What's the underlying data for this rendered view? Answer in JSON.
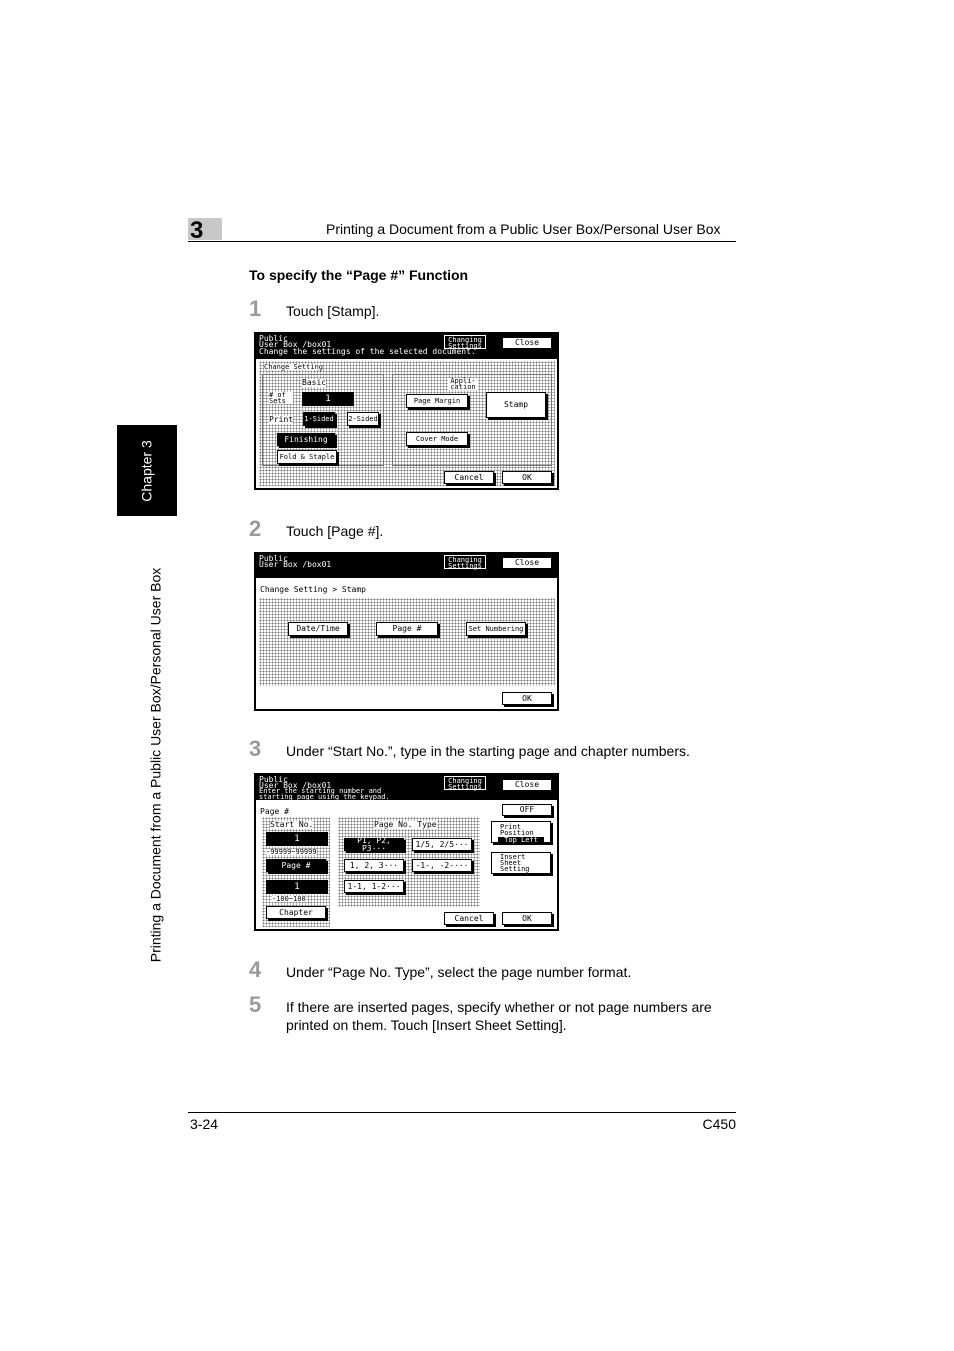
{
  "header": {
    "chapter_number": "3",
    "title": "Printing a Document from a Public User Box/Personal User Box"
  },
  "section_title": "To specify the “Page #” Function",
  "side": {
    "tab_label": "Chapter 3",
    "vertical_title": "Printing a Document from a Public User Box/Personal User Box"
  },
  "steps": [
    {
      "num": "1",
      "text": "Touch [Stamp]."
    },
    {
      "num": "2",
      "text": "Touch [Page #]."
    },
    {
      "num": "3",
      "text": "Under “Start No.”, type in the starting page and chapter numbers."
    },
    {
      "num": "4",
      "text": "Under “Page No. Type”, select the page number format."
    },
    {
      "num": "5",
      "text": "If there are inserted pages, specify whether or not page numbers are printed on them. Touch [Insert Sheet Setting]."
    }
  ],
  "screen1": {
    "top_line1": "Public",
    "top_line2": "User Box  /box01",
    "top_line3": "Change the settings of the selected document.",
    "chip": "Changing Settings",
    "close": "Close",
    "change_setting": "Change Setting",
    "basic": "Basic",
    "application": "Appli- cation",
    "num_sets_label": "# of Sets",
    "num_sets_value": "1",
    "print_label": "Print",
    "one_sided": "1-Sided",
    "two_sided": "2-Sided",
    "finishing": "Finishing",
    "fold_staple": "Fold & Staple",
    "page_margin": "Page Margin",
    "stamp": "Stamp",
    "cover_mode": "Cover Mode",
    "cancel": "Cancel",
    "ok": "OK"
  },
  "screen2": {
    "top_line1": "Public",
    "top_line2": "User Box  /box01",
    "chip": "Changing Settings",
    "close": "Close",
    "breadcrumb": "Change Setting > Stamp",
    "date_time": "Date/Time",
    "page_num": "Page #",
    "set_numbering": "Set Numbering",
    "ok": "OK"
  },
  "screen3": {
    "top_line1": "Public",
    "top_line2": "User Box  /box01",
    "top_line3": "Enter the starting number and",
    "top_line4": "starting page using the keypad.",
    "chip": "Changing Settings",
    "close": "Close",
    "page_label": "Page #",
    "off": "OFF",
    "start_no": "Start No.",
    "page_value": "1",
    "page_range": "-99999~99999",
    "page_btn": "Page #",
    "chapter_value": "1",
    "chapter_range": "-100~100",
    "chapter_btn": "Chapter",
    "page_no_type": "Page No. Type",
    "type1": "P1, P2, P3···",
    "type2": "1/5, 2/5···",
    "type3": "1, 2, 3···",
    "type4": "-1-, -2-···",
    "type5": "1-1, 1-2···",
    "print_position": "Print Position",
    "print_position_value": "Top Left",
    "insert_sheet": "Insert Sheet Setting",
    "cancel": "Cancel",
    "ok": "OK"
  },
  "footer": {
    "page": "3-24",
    "model": "C450"
  }
}
